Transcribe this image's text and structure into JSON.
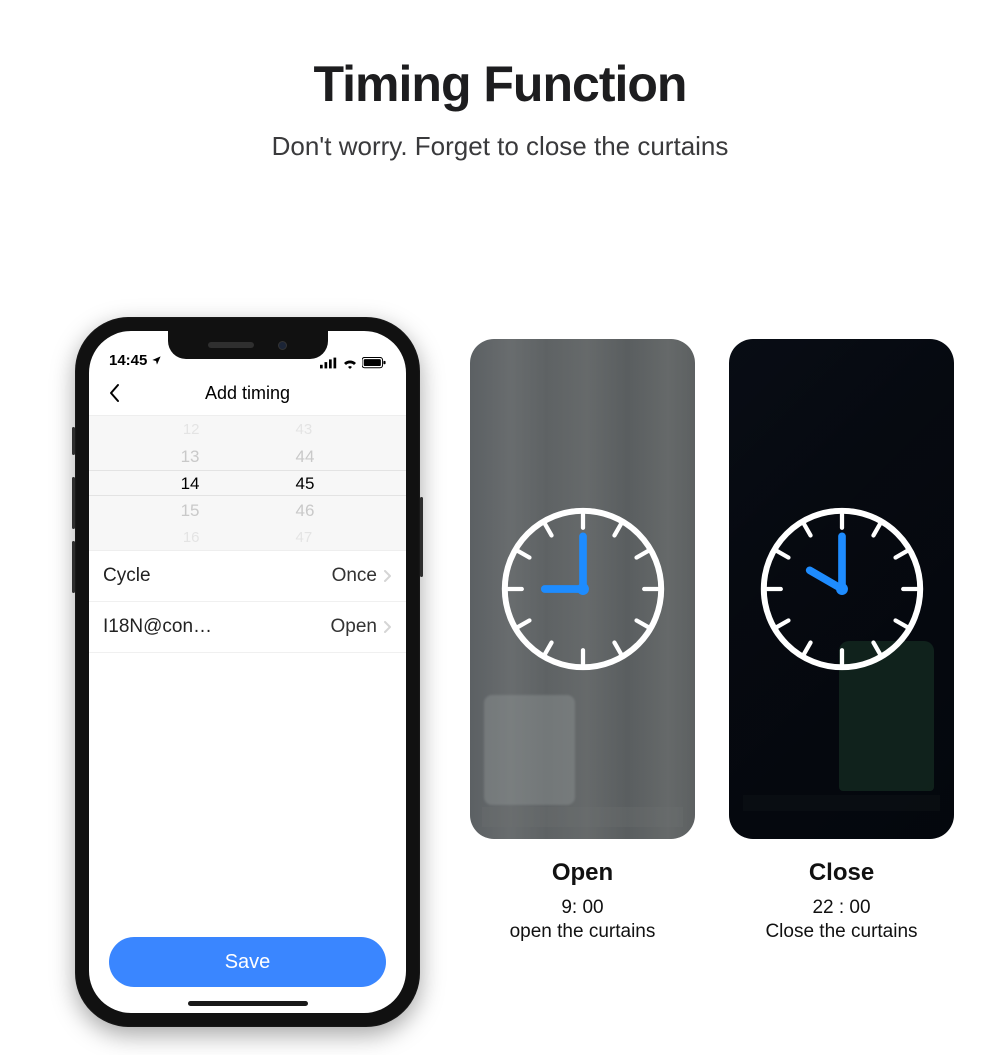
{
  "headline": "Timing Function",
  "subhead": "Don't worry. Forget to close the curtains",
  "status": {
    "time": "14:45"
  },
  "nav": {
    "title": "Add timing"
  },
  "picker": {
    "hours": [
      "12",
      "13",
      "14",
      "15",
      "16"
    ],
    "minutes": [
      "43",
      "44",
      "45",
      "46",
      "47"
    ]
  },
  "rows": {
    "cycle": {
      "label": "Cycle",
      "value": "Once"
    },
    "control": {
      "label": "I18N@con…",
      "value": "Open"
    }
  },
  "save_label": "Save",
  "cards": {
    "open": {
      "title": "Open",
      "time": "9: 00",
      "desc": "open the curtains"
    },
    "close": {
      "title": "Close",
      "time": "22 : 00",
      "desc": "Close the curtains"
    }
  }
}
